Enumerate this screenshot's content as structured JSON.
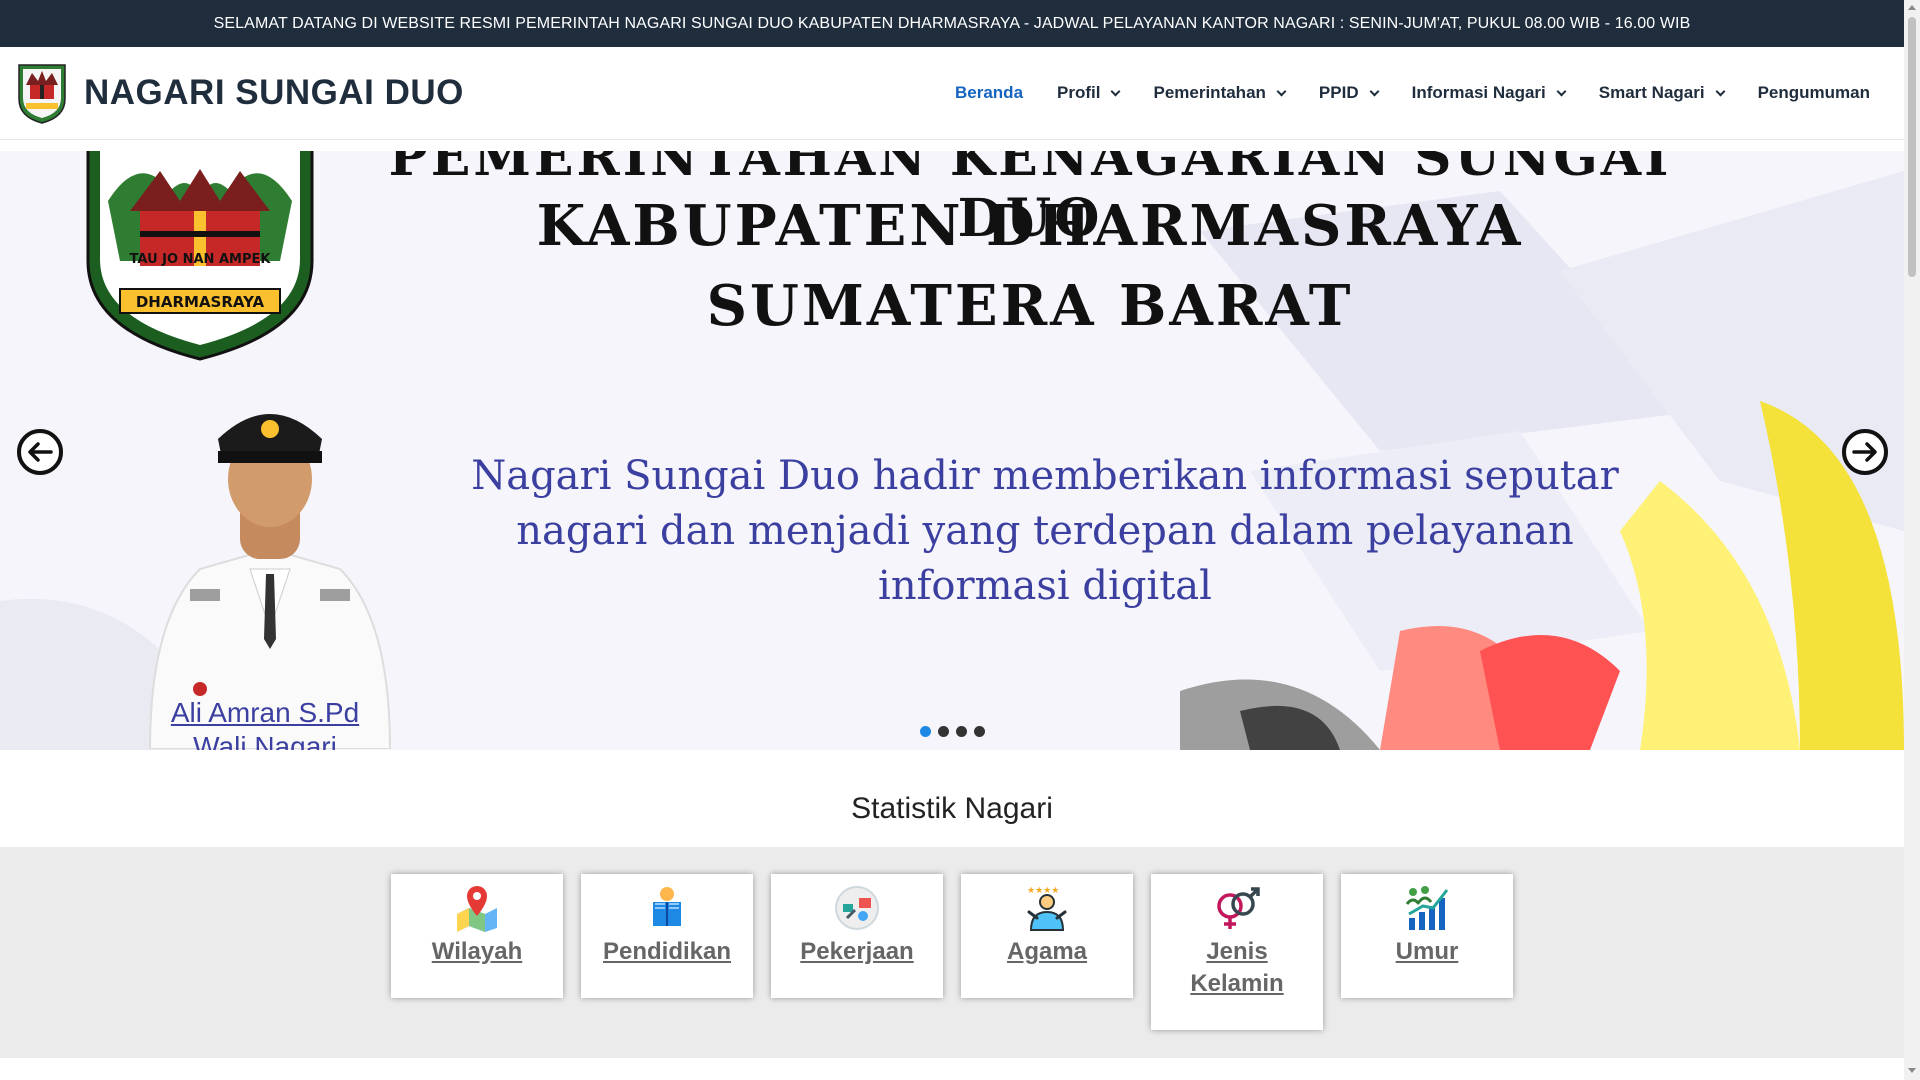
{
  "topbar": {
    "announcement": "SELAMAT DATANG DI WEBSITE RESMI PEMERINTAH NAGARI SUNGAI DUO KABUPATEN DHARMASRAYA - JADWAL PELAYANAN KANTOR NAGARI : SENIN-JUM'AT, PUKUL 08.00 WIB - 16.00 WIB"
  },
  "header": {
    "site_name": "NAGARI SUNGAI DUO",
    "nav": [
      {
        "label": "Beranda",
        "dropdown": false,
        "active": true
      },
      {
        "label": "Profil",
        "dropdown": true
      },
      {
        "label": "Pemerintahan",
        "dropdown": true
      },
      {
        "label": "PPID",
        "dropdown": true
      },
      {
        "label": "Informasi Nagari",
        "dropdown": true
      },
      {
        "label": "Smart Nagari",
        "dropdown": true
      },
      {
        "label": "Pengumuman",
        "dropdown": false
      }
    ]
  },
  "slider": {
    "title_line1": "PEMERINTAHAN KENAGARIAN SUNGAI DUO",
    "title_line2": "KABUPATEN DHARMASRAYA",
    "title_line3": "SUMATERA BARAT",
    "tagline_line1": "Nagari Sungai Duo hadir memberikan informasi seputar",
    "tagline_line2": "nagari dan menjadi yang terdepan dalam pelayanan",
    "tagline_line3": "informasi digital",
    "official_name": "Ali Amran S.Pd",
    "official_role": "Wali Nagari",
    "emblem_motto": "TAU JO NAN AMPEK",
    "emblem_region": "DHARMASRAYA",
    "slide_count": 4,
    "active_slide": 1
  },
  "stats": {
    "title": "Statistik Nagari",
    "items": [
      {
        "label": "Wilayah",
        "icon": "map-pin-icon"
      },
      {
        "label": "Pendidikan",
        "icon": "reading-book-icon"
      },
      {
        "label": "Pekerjaan",
        "icon": "work-tools-icon"
      },
      {
        "label": "Agama",
        "icon": "religion-person-icon"
      },
      {
        "label_line1": "Jenis",
        "label_line2": "Kelamin",
        "icon": "gender-symbols-icon"
      },
      {
        "label": "Umur",
        "icon": "growth-chart-icon"
      }
    ]
  },
  "colors": {
    "topbar_bg": "#1f2d3d",
    "nav_active": "#1565c0",
    "tagline": "#3b3fa0",
    "dot_active": "#1e88e5"
  }
}
